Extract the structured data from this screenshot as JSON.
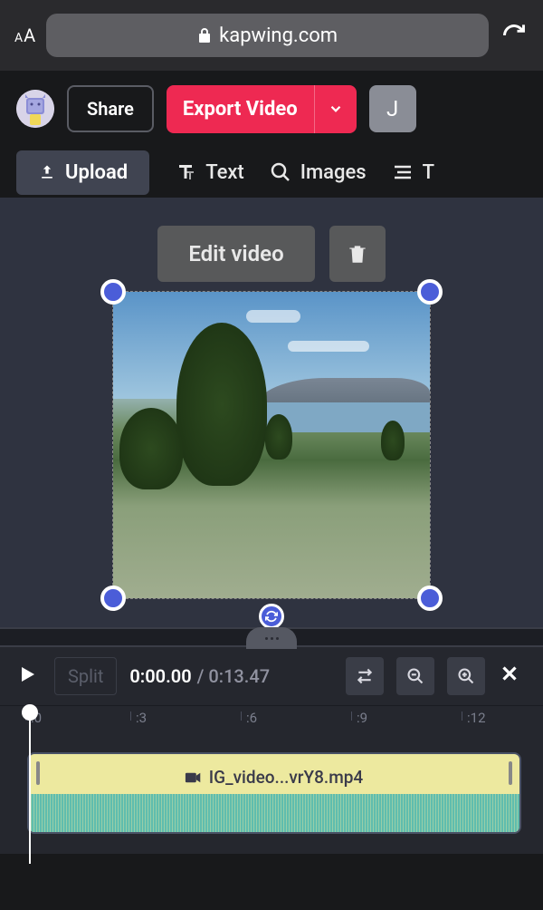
{
  "browser": {
    "url": "kapwing.com"
  },
  "header": {
    "share_label": "Share",
    "export_label": "Export Video",
    "user_initial": "J"
  },
  "toolbar": {
    "upload_label": "Upload",
    "text_label": "Text",
    "images_label": "Images"
  },
  "canvas": {
    "edit_label": "Edit video"
  },
  "timeline": {
    "split_label": "Split",
    "current_time": "0:00.00",
    "total_time": "0:13.47",
    "ruler_ticks": [
      ":0",
      ":3",
      ":6",
      ":9",
      ":12"
    ],
    "clip_filename": "IG_video...vrY8.mp4"
  }
}
